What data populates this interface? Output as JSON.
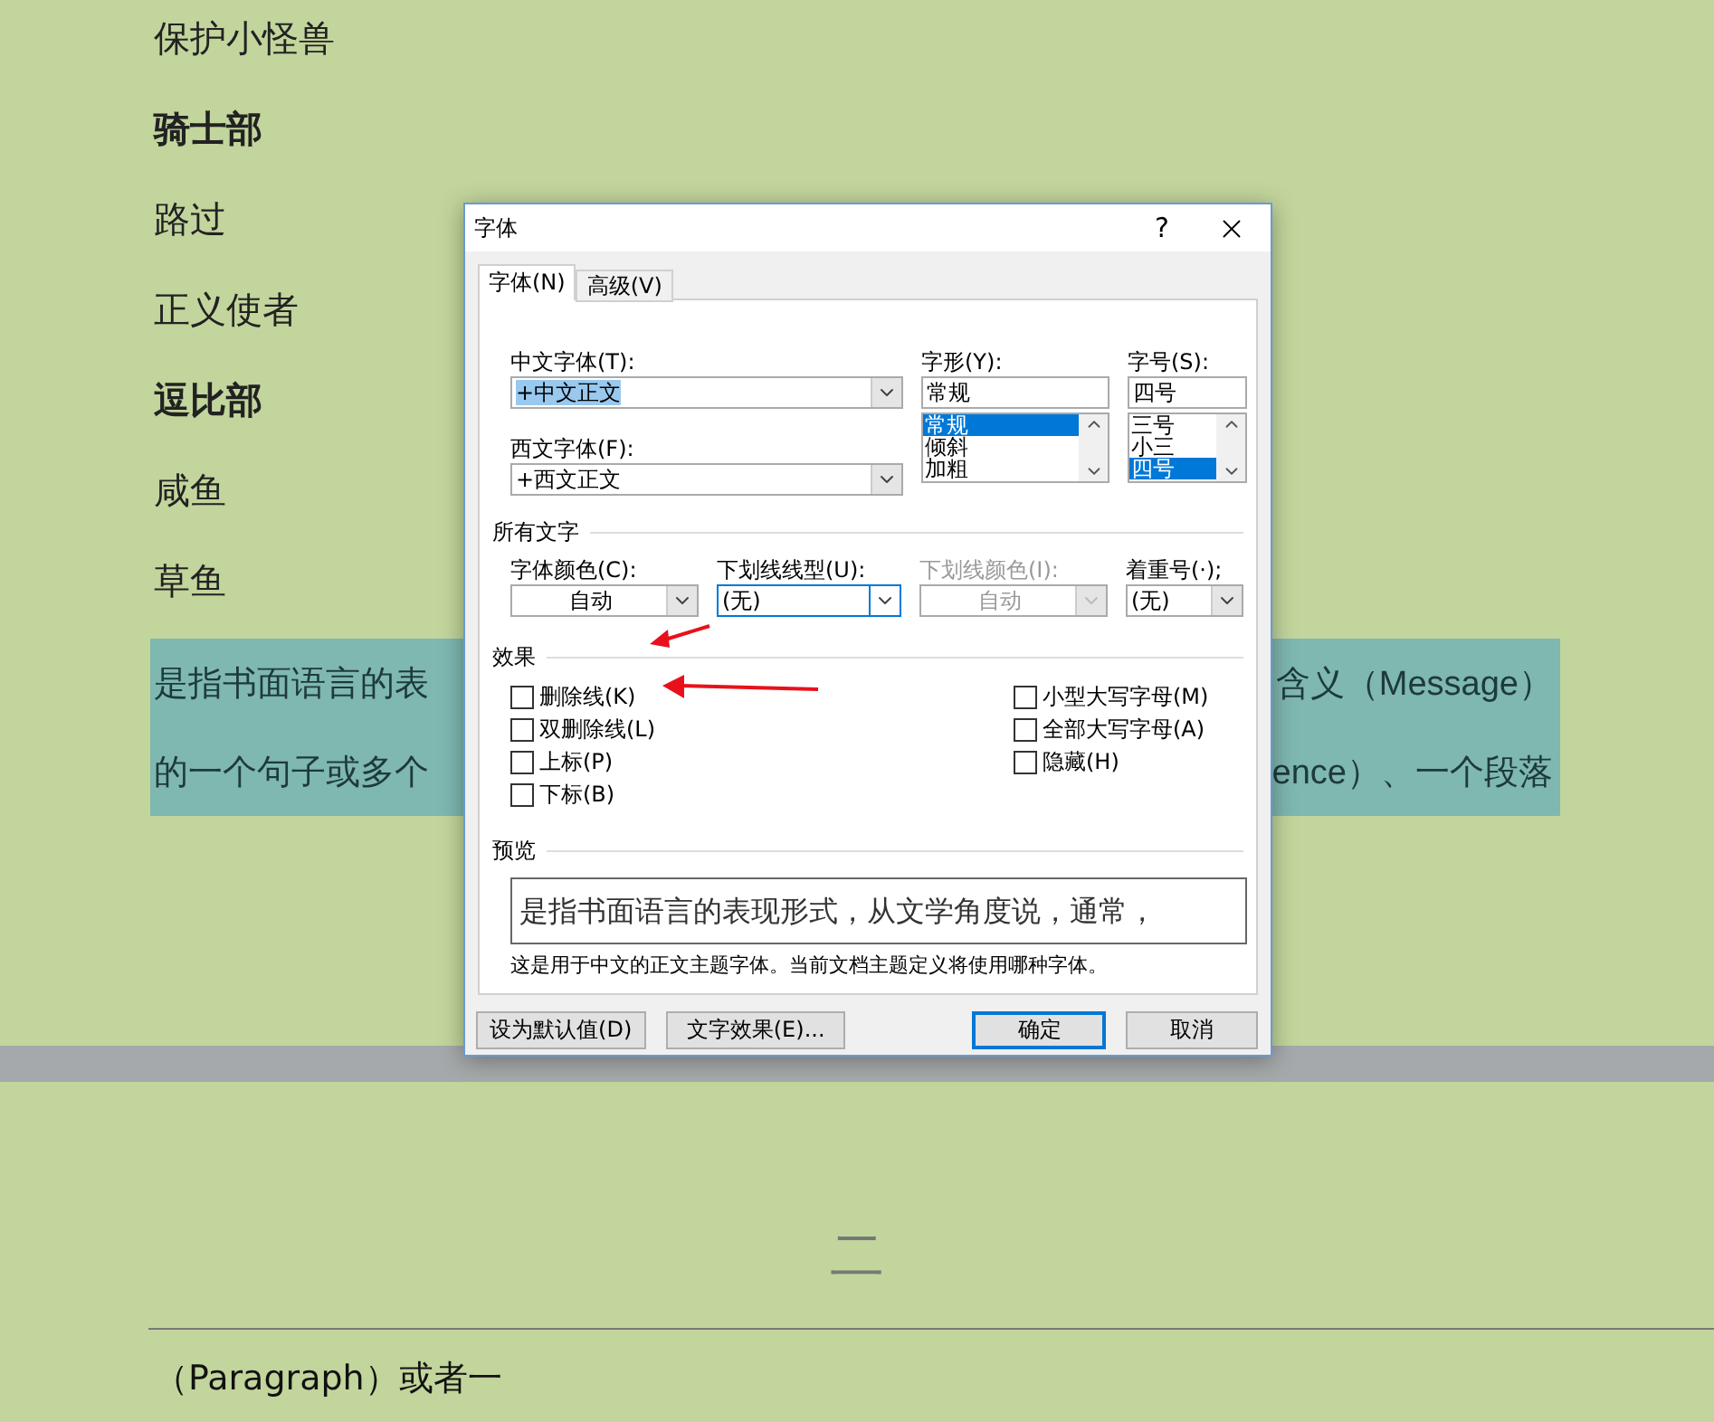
{
  "document": {
    "lines": [
      {
        "text": "保护小怪兽",
        "bold": false
      },
      {
        "text": "骑士部",
        "bold": true
      },
      {
        "text": "路过",
        "bold": false
      },
      {
        "text": "正义使者",
        "bold": false
      },
      {
        "text": "逗比部",
        "bold": true
      },
      {
        "text": "咸鱼",
        "bold": false
      },
      {
        "text": "草鱼",
        "bold": false
      }
    ],
    "highlighted": [
      {
        "left": "是指书面语言的表",
        "right": "含义（Message）"
      },
      {
        "left": "的一个句子或多个",
        "right": "ence）、一个段落"
      }
    ],
    "page_header": "二",
    "page_text": "（Paragraph）或者一"
  },
  "dialog": {
    "title": "字体",
    "help": "?",
    "tabs": [
      {
        "label": "字体(N)",
        "selected": true
      },
      {
        "label": "高级(V)",
        "selected": false
      }
    ],
    "chinese_font": {
      "label": "中文字体(T):",
      "value": "+中文正文"
    },
    "western_font": {
      "label": "西文字体(F):",
      "value": "+西文正文"
    },
    "style": {
      "label": "字形(Y):",
      "value": "常规",
      "options": [
        {
          "text": "常规",
          "selected": true
        },
        {
          "text": "倾斜",
          "selected": false
        },
        {
          "text": "加粗",
          "selected": false
        }
      ]
    },
    "size": {
      "label": "字号(S):",
      "value": "四号",
      "options": [
        {
          "text": "三号",
          "selected": false
        },
        {
          "text": "小三",
          "selected": false
        },
        {
          "text": "四号",
          "selected": true
        }
      ]
    },
    "all_text": {
      "title": "所有文字",
      "dropdowns": [
        {
          "label": "字体颜色(C):",
          "value": "自动",
          "disabled": false,
          "focused": false,
          "centered": true
        },
        {
          "label": "下划线线型(U):",
          "value": "(无)",
          "disabled": false,
          "focused": true,
          "centered": false
        },
        {
          "label": "下划线颜色(I):",
          "value": "自动",
          "disabled": true,
          "focused": false,
          "centered": true
        },
        {
          "label": "着重号(·);",
          "value": "(无)",
          "disabled": false,
          "focused": false,
          "centered": false
        }
      ]
    },
    "effects": {
      "title": "效果",
      "left": [
        {
          "label": "删除线(K)",
          "checked": false
        },
        {
          "label": "双删除线(L)",
          "checked": false
        },
        {
          "label": "上标(P)",
          "checked": false
        },
        {
          "label": "下标(B)",
          "checked": false
        }
      ],
      "right": [
        {
          "label": "小型大写字母(M)",
          "checked": false
        },
        {
          "label": "全部大写字母(A)",
          "checked": false
        },
        {
          "label": "隐藏(H)",
          "checked": false
        }
      ]
    },
    "preview": {
      "title": "预览",
      "text": "是指书面语言的表现形式，从文学角度说，通常，",
      "description": "这是用于中文的正文主题字体。当前文档主题定义将使用哪种字体。"
    },
    "buttons": [
      {
        "label": "设为默认值(D)",
        "default": false
      },
      {
        "label": "文字效果(E)...",
        "default": false
      },
      {
        "label": "确定",
        "default": true
      },
      {
        "label": "取消",
        "default": false
      }
    ]
  }
}
